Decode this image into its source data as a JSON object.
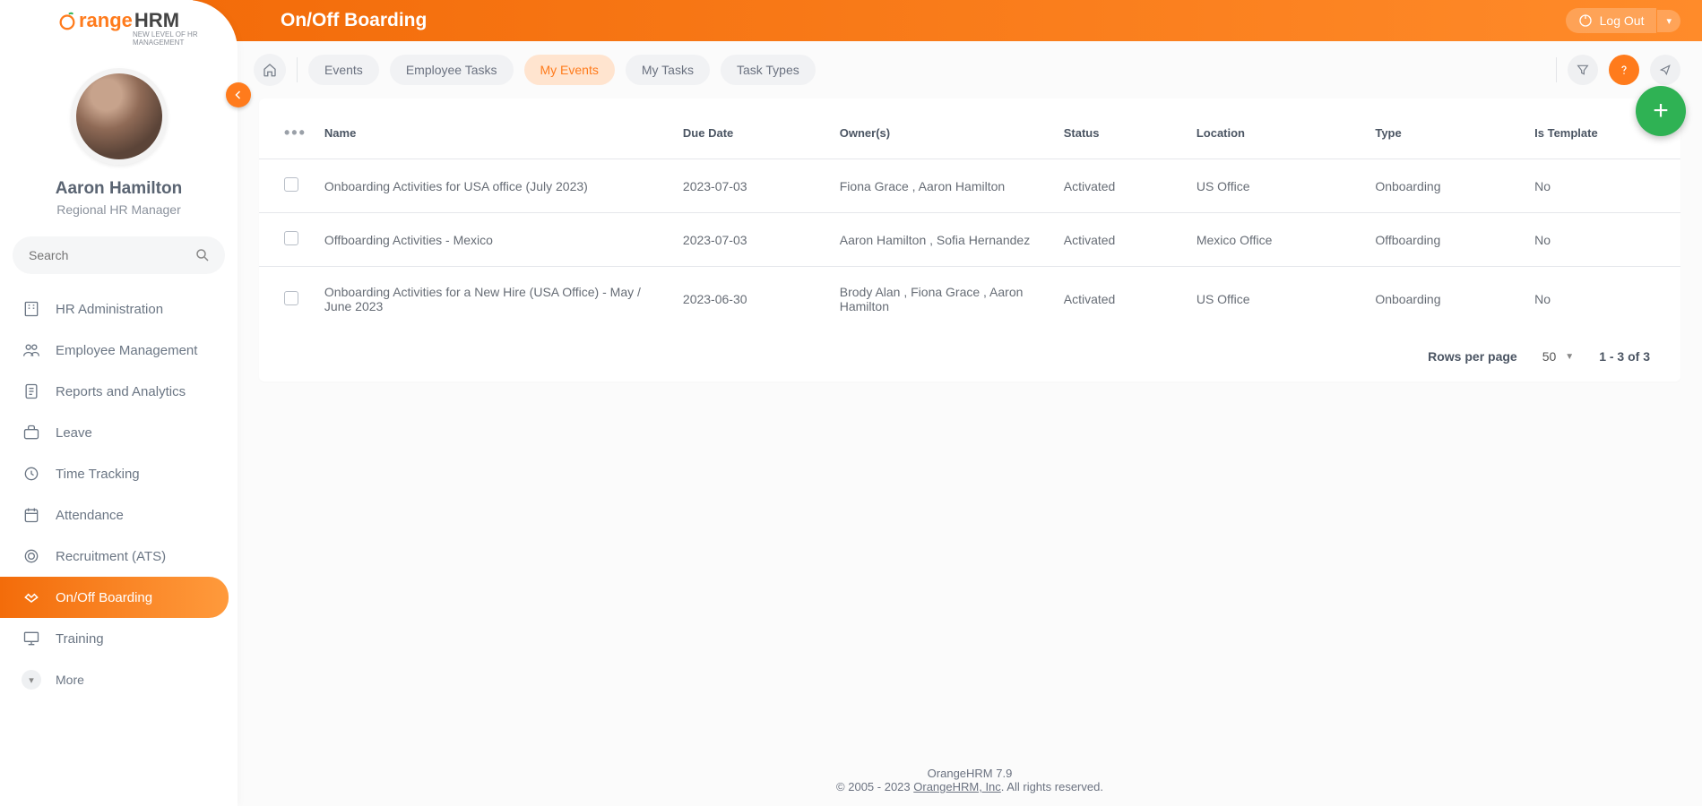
{
  "brand": {
    "name_a": "range",
    "name_b": "HRM",
    "tagline": "NEW LEVEL OF HR MANAGEMENT"
  },
  "user": {
    "name": "Aaron Hamilton",
    "role": "Regional HR Manager"
  },
  "search": {
    "placeholder": "Search"
  },
  "nav": {
    "items": [
      {
        "label": "HR Administration"
      },
      {
        "label": "Employee Management"
      },
      {
        "label": "Reports and Analytics"
      },
      {
        "label": "Leave"
      },
      {
        "label": "Time Tracking"
      },
      {
        "label": "Attendance"
      },
      {
        "label": "Recruitment (ATS)"
      },
      {
        "label": "On/Off Boarding",
        "active": true
      },
      {
        "label": "Training"
      }
    ],
    "more": "More"
  },
  "header": {
    "title": "On/Off Boarding",
    "logout": "Log Out"
  },
  "tabs": [
    {
      "label": "Events"
    },
    {
      "label": "Employee Tasks"
    },
    {
      "label": "My Events",
      "active": true
    },
    {
      "label": "My Tasks"
    },
    {
      "label": "Task Types"
    }
  ],
  "table": {
    "columns": {
      "name": "Name",
      "due": "Due Date",
      "owners": "Owner(s)",
      "status": "Status",
      "location": "Location",
      "type": "Type",
      "template": "Is Template"
    },
    "rows": [
      {
        "name": "Onboarding Activities for USA office (July 2023)",
        "due": "2023-07-03",
        "owners": "Fiona Grace , Aaron Hamilton",
        "status": "Activated",
        "location": "US Office",
        "type": "Onboarding",
        "template": "No"
      },
      {
        "name": "Offboarding Activities - Mexico",
        "due": "2023-07-03",
        "owners": "Aaron Hamilton , Sofia Hernandez",
        "status": "Activated",
        "location": "Mexico Office",
        "type": "Offboarding",
        "template": "No"
      },
      {
        "name": "Onboarding Activities for a New Hire (USA Office) - May / June 2023",
        "due": "2023-06-30",
        "owners": "Brody Alan , Fiona Grace , Aaron Hamilton",
        "status": "Activated",
        "location": "US Office",
        "type": "Onboarding",
        "template": "No"
      }
    ]
  },
  "pagination": {
    "label": "Rows per page",
    "per": "50",
    "range": "1 - 3 of 3"
  },
  "footer": {
    "version": "OrangeHRM 7.9",
    "copyright_a": "© 2005 - 2023 ",
    "link": "OrangeHRM, Inc",
    "copyright_b": ". All rights reserved."
  }
}
